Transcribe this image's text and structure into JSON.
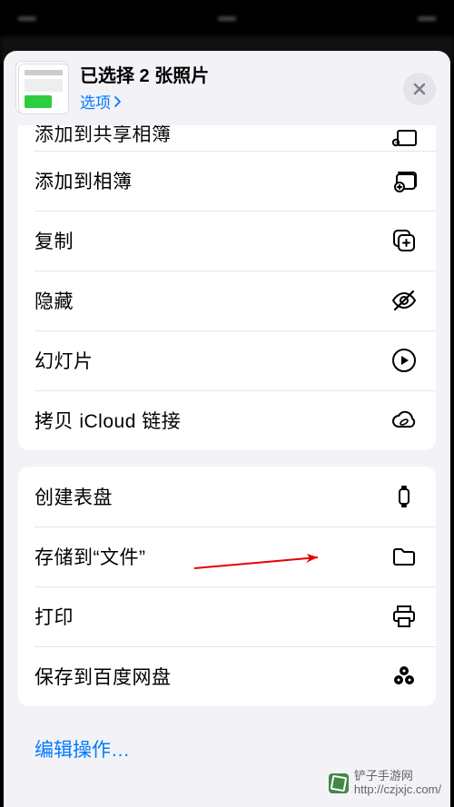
{
  "header": {
    "title": "已选择 2 张照片",
    "options_label": "选项"
  },
  "groups": [
    {
      "cutTop": true,
      "items": [
        {
          "label": "添加到共享相簿",
          "icon": "shared-album-icon",
          "cut": true
        },
        {
          "label": "添加到相簿",
          "icon": "album-add-icon"
        },
        {
          "label": "复制",
          "icon": "copy-icon"
        },
        {
          "label": "隐藏",
          "icon": "hide-icon"
        },
        {
          "label": "幻灯片",
          "icon": "slideshow-icon"
        },
        {
          "label": "拷贝 iCloud 链接",
          "icon": "icloud-link-icon"
        }
      ]
    },
    {
      "items": [
        {
          "label": "创建表盘",
          "icon": "watch-face-icon"
        },
        {
          "label": "存储到“文件”",
          "icon": "folder-icon",
          "arrow": true
        },
        {
          "label": "打印",
          "icon": "print-icon"
        },
        {
          "label": "保存到百度网盘",
          "icon": "baidu-pan-icon"
        }
      ]
    }
  ],
  "edit_actions_label": "编辑操作…",
  "watermark": {
    "line1": "铲子手游网",
    "line2": "http://czjxjc.com/"
  }
}
